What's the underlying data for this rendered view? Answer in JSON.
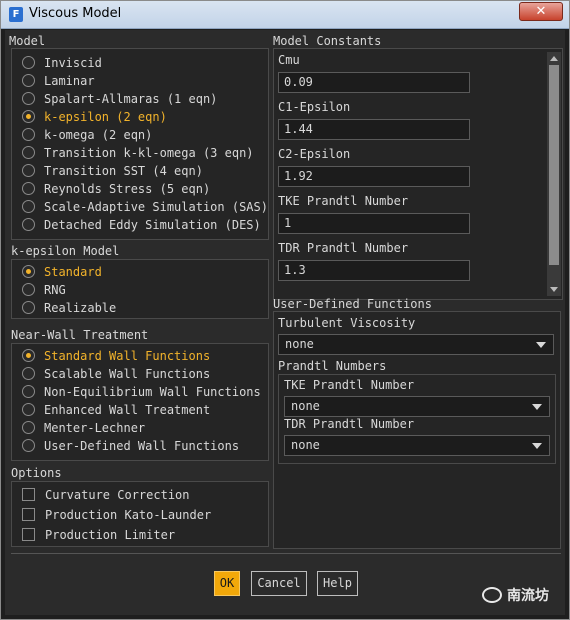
{
  "window": {
    "title": "Viscous Model",
    "app_icon": "F",
    "close_glyph": "✕"
  },
  "model": {
    "title": "Model",
    "options": [
      {
        "label": "Inviscid",
        "selected": false
      },
      {
        "label": "Laminar",
        "selected": false
      },
      {
        "label": "Spalart-Allmaras (1 eqn)",
        "selected": false
      },
      {
        "label": "k-epsilon (2 eqn)",
        "selected": true
      },
      {
        "label": "k-omega (2 eqn)",
        "selected": false
      },
      {
        "label": "Transition k-kl-omega (3 eqn)",
        "selected": false
      },
      {
        "label": "Transition SST (4 eqn)",
        "selected": false
      },
      {
        "label": "Reynolds Stress (5 eqn)",
        "selected": false
      },
      {
        "label": "Scale-Adaptive Simulation (SAS)",
        "selected": false
      },
      {
        "label": "Detached Eddy Simulation (DES)",
        "selected": false
      }
    ]
  },
  "ke_model": {
    "title": "k-epsilon Model",
    "options": [
      {
        "label": "Standard",
        "selected": true
      },
      {
        "label": "RNG",
        "selected": false
      },
      {
        "label": "Realizable",
        "selected": false
      }
    ]
  },
  "near_wall": {
    "title": "Near-Wall Treatment",
    "options": [
      {
        "label": "Standard Wall Functions",
        "selected": true
      },
      {
        "label": "Scalable Wall Functions",
        "selected": false
      },
      {
        "label": "Non-Equilibrium Wall Functions",
        "selected": false
      },
      {
        "label": "Enhanced Wall Treatment",
        "selected": false
      },
      {
        "label": "Menter-Lechner",
        "selected": false
      },
      {
        "label": "User-Defined Wall Functions",
        "selected": false
      }
    ]
  },
  "options": {
    "title": "Options",
    "items": [
      {
        "label": "Curvature Correction",
        "checked": false
      },
      {
        "label": "Production Kato-Launder",
        "checked": false
      },
      {
        "label": "Production Limiter",
        "checked": false
      }
    ]
  },
  "constants": {
    "title": "Model Constants",
    "items": [
      {
        "label": "Cmu",
        "value": "0.09"
      },
      {
        "label": "C1-Epsilon",
        "value": "1.44"
      },
      {
        "label": "C2-Epsilon",
        "value": "1.92"
      },
      {
        "label": "TKE Prandtl Number",
        "value": "1"
      },
      {
        "label": "TDR Prandtl Number",
        "value": "1.3"
      }
    ]
  },
  "udf": {
    "title": "User-Defined Functions",
    "turbulent_viscosity": {
      "label": "Turbulent Viscosity",
      "value": "none"
    },
    "prandtl": {
      "title": "Prandtl Numbers",
      "tke": {
        "label": "TKE Prandtl Number",
        "value": "none"
      },
      "tdr": {
        "label": "TDR Prandtl Number",
        "value": "none"
      }
    }
  },
  "buttons": {
    "ok": "OK",
    "cancel": "Cancel",
    "help": "Help"
  },
  "watermark": {
    "text": "南流坊"
  },
  "colors": {
    "accent": "#f2a80a",
    "selected_text": "#f2b32b",
    "background": "#2b2b2b"
  }
}
